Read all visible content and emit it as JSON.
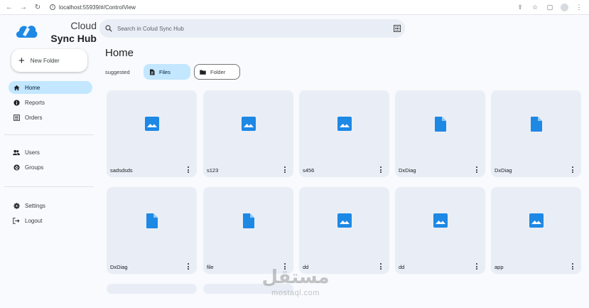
{
  "browser": {
    "url": "localhost:55939/#/ControlView"
  },
  "app": {
    "name_line1": "Cloud",
    "name_line2": "Sync Hub",
    "accent_color": "#1e88e5",
    "active_color": "#c2e7ff"
  },
  "sidebar": {
    "new_folder_label": "New Folder",
    "items": [
      {
        "label": "Home",
        "icon": "home-icon",
        "active": true
      },
      {
        "label": "Reports",
        "icon": "info-icon",
        "active": false
      },
      {
        "label": "Orders",
        "icon": "list-icon",
        "active": false
      },
      {
        "label": "Users",
        "icon": "users-icon",
        "active": false
      },
      {
        "label": "Groups",
        "icon": "groups-icon",
        "active": false
      },
      {
        "label": "Settings",
        "icon": "gear-icon",
        "active": false
      },
      {
        "label": "Logout",
        "icon": "logout-icon",
        "active": false
      }
    ]
  },
  "search": {
    "placeholder": "Search in Colud Sync Hub"
  },
  "main": {
    "title": "Home",
    "suggested_label": "suggested",
    "chips": [
      {
        "label": "Files",
        "icon": "file-icon",
        "selected": true
      },
      {
        "label": "Folder",
        "icon": "folder-icon",
        "selected": false
      }
    ],
    "files": [
      {
        "name": "sadsdsds",
        "type": "image"
      },
      {
        "name": "s123",
        "type": "image"
      },
      {
        "name": "s456",
        "type": "image"
      },
      {
        "name": "DxDiag",
        "type": "document"
      },
      {
        "name": "DxDiag",
        "type": "document"
      },
      {
        "name": "DxDiag",
        "type": "document"
      },
      {
        "name": "file",
        "type": "document"
      },
      {
        "name": "dd",
        "type": "image"
      },
      {
        "name": "dd",
        "type": "image"
      },
      {
        "name": "app",
        "type": "image"
      }
    ]
  },
  "watermark": {
    "arabic": "مستقل",
    "latin": "mostaql.com"
  }
}
